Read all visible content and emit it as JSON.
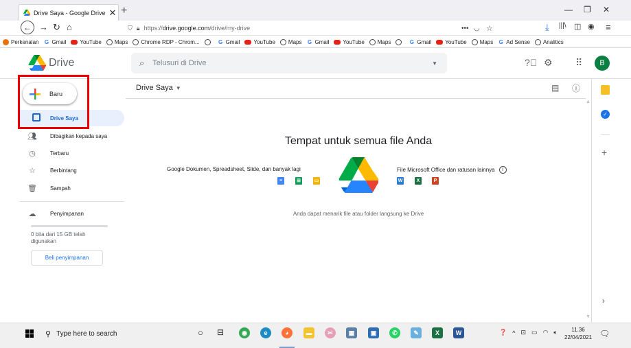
{
  "browser": {
    "tab_title": "Drive Saya - Google Drive",
    "tab_close": "✕",
    "new_tab": "+",
    "url_prefix": "https://",
    "url_domain": "drive.google.com",
    "url_path": "/drive/my-drive",
    "bookmarks": [
      {
        "label": "Perkenalan",
        "icon": "perk"
      },
      {
        "label": "Gmail",
        "icon": "g"
      },
      {
        "label": "YouTube",
        "icon": "yt"
      },
      {
        "label": "Maps",
        "icon": "globe"
      },
      {
        "label": "Chrome RDP - Chrom...",
        "icon": "globe"
      },
      {
        "label": "",
        "icon": "globe"
      },
      {
        "label": "Gmail",
        "icon": "g"
      },
      {
        "label": "YouTube",
        "icon": "yt"
      },
      {
        "label": "Maps",
        "icon": "globe"
      },
      {
        "label": "Gmail",
        "icon": "g"
      },
      {
        "label": "YouTube",
        "icon": "yt"
      },
      {
        "label": "Maps",
        "icon": "globe"
      },
      {
        "label": "",
        "icon": "globe"
      },
      {
        "label": "Gmail",
        "icon": "g"
      },
      {
        "label": "YouTube",
        "icon": "yt"
      },
      {
        "label": "Maps",
        "icon": "globe"
      },
      {
        "label": "Ad Sense",
        "icon": "g"
      },
      {
        "label": "Analitics",
        "icon": "globe"
      }
    ]
  },
  "header": {
    "app_name": "Drive",
    "search_placeholder": "Telusuri di Drive",
    "avatar_letter": "B"
  },
  "sidebar": {
    "new_label": "Baru",
    "items": [
      {
        "label": "Drive Saya",
        "icon": "drive-icon"
      },
      {
        "label": "Dibagikan kepada saya",
        "icon": "shared-icon"
      },
      {
        "label": "Terbaru",
        "icon": "clock-icon"
      },
      {
        "label": "Berbintang",
        "icon": "star-icon"
      },
      {
        "label": "Sampah",
        "icon": "trash-icon"
      }
    ],
    "storage_label": "Penyimpanan",
    "storage_usage": "0 bita dari 15 GB telah digunakan",
    "buy_storage": "Beli penyimpanan"
  },
  "main": {
    "title": "Drive Saya",
    "empty_title": "Tempat untuk semua file Anda",
    "google_apps_text": "Google Dokumen, Spreadsheet, Slide, dan banyak lagi",
    "ms_apps_text": "File Microsoft Office dan ratusan lainnya",
    "drag_hint": "Anda dapat menarik file atau folder langsung ke Drive"
  },
  "taskbar": {
    "search_placeholder": "Type here to search",
    "time": "11.36",
    "date": "22/04/2021"
  },
  "colors": {
    "accent": "#1a73e8",
    "highlight_box": "#e00000",
    "avatar": "#0b8043"
  }
}
